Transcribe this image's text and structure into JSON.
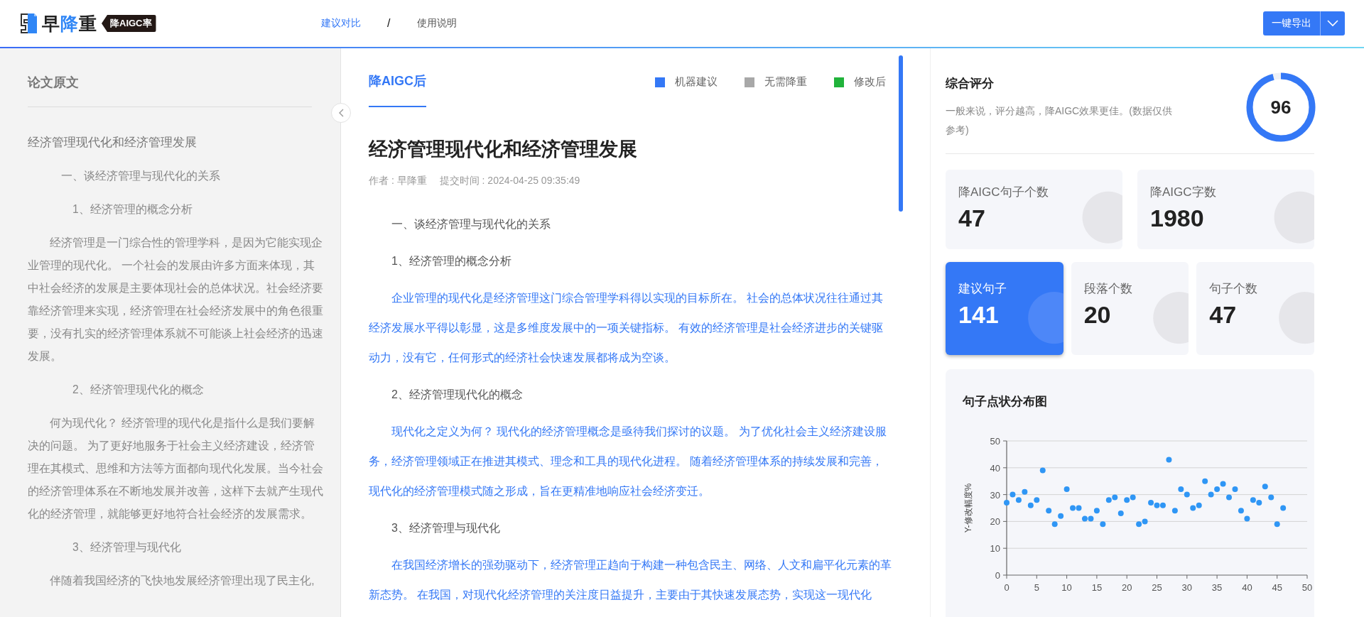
{
  "header": {
    "logo": {
      "name": [
        {
          "text": "早",
          "highlight": false
        },
        {
          "text": "降",
          "highlight": true
        },
        {
          "text": "重",
          "highlight": false
        }
      ],
      "tag": "降AIGC率"
    },
    "nav": [
      {
        "label": "建议对比",
        "selected": true
      },
      {
        "label": "使用说明",
        "selected": false
      }
    ],
    "nav_separator": "/",
    "export_button": "一键导出"
  },
  "original_panel": {
    "title": "论文原文",
    "paragraphs": [
      {
        "kind": "title",
        "text": "经济管理现代化和经济管理发展"
      },
      {
        "kind": "h1",
        "text": "一、谈经济管理与现代化的关系"
      },
      {
        "kind": "h2",
        "text": "1、经济管理的概念分析"
      },
      {
        "kind": "text",
        "text": "经济管理是一门综合性的管理学科，是因为它能实现企业管理的现代化。 一个社会的发展由许多方面来体现，其中社会经济的发展是主要体现社会的总体状况。社会经济要靠经济管理来实现，经济管理在社会经济发展中的角色很重要，没有扎实的经济管理体系就不可能谈上社会经济的迅速发展。"
      },
      {
        "kind": "h2",
        "text": "2、经济管理现代化的概念"
      },
      {
        "kind": "text",
        "text": "何为现代化？ 经济管理的现代化是指什么是我们要解决的问题。 为了更好地服务于社会主义经济建设，经济管理在其模式、思维和方法等方面都向现代化发展。当今社会的经济管理体系在不断地发展并改善，这样下去就产生现代化的经济管理，就能够更好地符合社会经济的发展需求。"
      },
      {
        "kind": "h2",
        "text": "3、经济管理与现代化"
      },
      {
        "kind": "text",
        "text": "伴随着我国经济的飞快地发展经济管理出现了民主化,"
      }
    ]
  },
  "rewritten_panel": {
    "tab": "降AIGC后",
    "legend": [
      {
        "label": "机器建议",
        "color": "#3478f6"
      },
      {
        "label": "无需降重",
        "color": "#a8a8a8"
      },
      {
        "label": "修改后",
        "color": "#21b33b"
      }
    ],
    "title": "经济管理现代化和经济管理发展",
    "author": "作者 : 早降重",
    "submitted": "提交时间 : 2024-04-25 09:35:49",
    "paragraphs": [
      {
        "kind": "heading",
        "text": "一、谈经济管理与现代化的关系"
      },
      {
        "kind": "heading",
        "text": "1、经济管理的概念分析"
      },
      {
        "kind": "text",
        "color": "#3478f6",
        "text": "企业管理的现代化是经济管理这门综合管理学科得以实现的目标所在。 社会的总体状况往往通过其经济发展水平得以彰显，这是多维度发展中的一项关键指标。 有效的经济管理是社会经济进步的关键驱动力，没有它，任何形式的经济社会快速发展都将成为空谈。"
      },
      {
        "kind": "heading",
        "text": "2、经济管理现代化的概念"
      },
      {
        "kind": "text",
        "color": "#3478f6",
        "text": "现代化之定义为何？ 现代化的经济管理概念是亟待我们探讨的议题。 为了优化社会主义经济建设服务，经济管理领域正在推进其模式、理念和工具的现代化进程。 随着经济管理体系的持续发展和完善，现代化的经济管理模式随之形成，旨在更精准地响应社会经济变迁。"
      },
      {
        "kind": "heading",
        "text": "3、经济管理与现代化"
      },
      {
        "kind": "text",
        "color": "#3478f6",
        "text": "在我国经济增长的强劲驱动下，经济管理正趋向于构建一种包含民主、网络、人文和扁平化元素的革新态势。 在我国，对现代化经济管理的关注度日益提升，主要由于其快速发展态势，实现这一现代化"
      }
    ]
  },
  "score": {
    "title": "综合评分",
    "description": "一般来说，评分越高，降AIGC效果更佳。(数据仅供参考)",
    "value": "96",
    "level": 0.96
  },
  "stats_top": [
    {
      "label": "降AIGC句子个数",
      "value": "47",
      "selected": false
    },
    {
      "label": "降AIGC字数",
      "value": "1980",
      "selected": false
    }
  ],
  "stats_bottom": [
    {
      "label": "建议句子",
      "value": "141",
      "selected": true
    },
    {
      "label": "段落个数",
      "value": "20",
      "selected": false
    },
    {
      "label": "句子个数",
      "value": "47",
      "selected": false
    }
  ],
  "chart": {
    "title": "句子点状分布图",
    "chart_data": {
      "type": "scatter",
      "ylabel": "Y-修改幅度%",
      "x": [
        0,
        1,
        2,
        3,
        4,
        5,
        6,
        7,
        8,
        9,
        10,
        11,
        12,
        13,
        14,
        15,
        16,
        17,
        18,
        19,
        20,
        21,
        22,
        23,
        24,
        25,
        26,
        27,
        28,
        29,
        30,
        31,
        32,
        33,
        34,
        35,
        36,
        37,
        38,
        39,
        40,
        41,
        42,
        43,
        44,
        45,
        46
      ],
      "grid": true,
      "series": [
        {
          "color": "#2f96f5",
          "values": [
            27,
            30,
            28,
            31,
            26,
            28,
            39,
            24,
            19,
            22,
            32,
            25,
            25,
            21,
            21,
            24,
            19,
            28,
            29,
            23,
            28,
            29,
            19,
            20,
            27,
            26,
            26,
            43,
            24,
            32,
            30,
            25,
            26,
            35,
            30,
            32,
            34,
            29,
            32,
            24,
            21,
            28,
            27,
            33,
            29,
            19,
            25
          ]
        }
      ],
      "xlim": [
        0,
        50
      ],
      "ylim": [
        0,
        50
      ],
      "xticks": [
        0,
        5,
        10,
        15,
        20,
        25,
        30,
        35,
        40,
        45,
        50
      ],
      "yticks": [
        0,
        10,
        20,
        30,
        40,
        50
      ]
    }
  }
}
